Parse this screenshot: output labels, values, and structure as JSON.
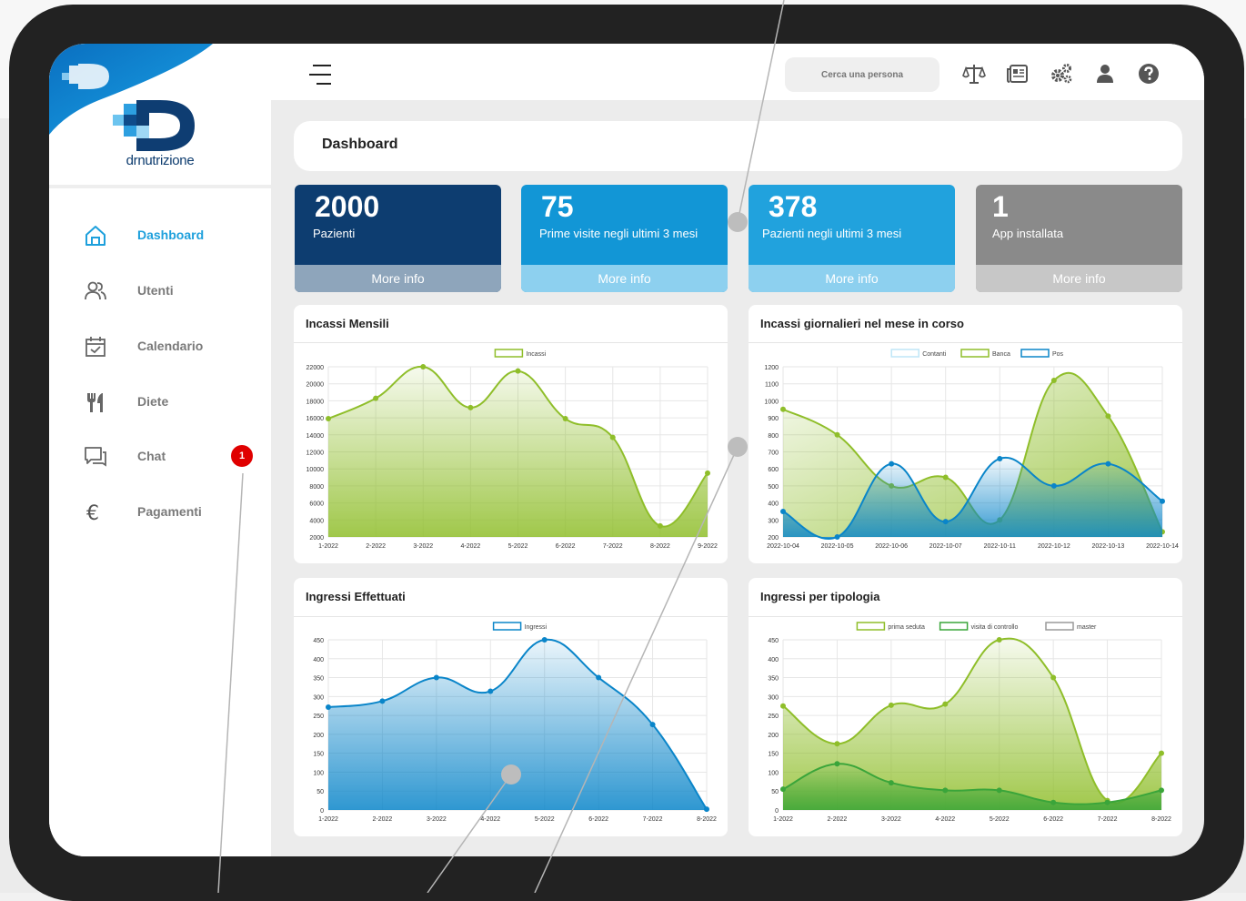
{
  "app": {
    "brand": "drnutrizione"
  },
  "sidebar": {
    "items": [
      {
        "label": "Dashboard",
        "icon": "home-icon"
      },
      {
        "label": "Utenti",
        "icon": "users-icon"
      },
      {
        "label": "Calendario",
        "icon": "calendar-check-icon"
      },
      {
        "label": "Diete",
        "icon": "fork-knife-icon"
      },
      {
        "label": "Chat",
        "icon": "chat-icon",
        "badge": "1"
      },
      {
        "label": "Pagamenti",
        "icon": "euro-icon"
      }
    ]
  },
  "topbar": {
    "search_placeholder": "Cerca una persona",
    "icons": [
      "scale-icon",
      "newspaper-icon",
      "gears-icon",
      "user-icon",
      "help-icon"
    ]
  },
  "page": {
    "title": "Dashboard"
  },
  "stats": [
    {
      "value": "2000",
      "label": "Pazienti",
      "more": "More info",
      "color": "#0d3d70",
      "footer": "#8ea5bb"
    },
    {
      "value": "75",
      "label": "Prime visite negli ultimi 3 mesi",
      "more": "More info",
      "color": "#1296d6",
      "footer": "#8dd0ef"
    },
    {
      "value": "378",
      "label": "Pazienti negli ultimi 3 mesi",
      "more": "More info",
      "color": "#21a2dd",
      "footer": "#8dd0ef"
    },
    {
      "value": "1",
      "label": "App installata",
      "more": "More info",
      "color": "#8a8a8a",
      "footer": "#c7c7c7"
    }
  ],
  "panels": {
    "p1": {
      "title": "Incassi Mensili"
    },
    "p2": {
      "title": "Incassi giornalieri nel mese in corso"
    },
    "p3": {
      "title": "Ingressi Effettuati"
    },
    "p4": {
      "title": "Ingressi per tipologia"
    }
  },
  "chart_data": [
    {
      "type": "area",
      "title": "Incassi Mensili",
      "categories": [
        "1-2022",
        "2-2022",
        "3-2022",
        "4-2022",
        "5-2022",
        "6-2022",
        "7-2022",
        "8-2022",
        "9-2022"
      ],
      "ylim": [
        2000,
        22000
      ],
      "yticks": [
        2000,
        4000,
        6000,
        8000,
        10000,
        12000,
        14000,
        16000,
        18000,
        20000,
        22000
      ],
      "series": [
        {
          "name": "Incassi",
          "color": "#8fbe2a",
          "values": [
            15900,
            18300,
            22000,
            17200,
            21500,
            15900,
            13700,
            3300,
            9500
          ]
        }
      ]
    },
    {
      "type": "area",
      "title": "Incassi giornalieri nel mese in corso",
      "categories": [
        "2022-10-04",
        "2022-10-05",
        "2022-10-06",
        "2022-10-07",
        "2022-10-11",
        "2022-10-12",
        "2022-10-13",
        "2022-10-14"
      ],
      "ylim": [
        200,
        1200
      ],
      "yticks": [
        200,
        300,
        400,
        500,
        600,
        700,
        800,
        900,
        1000,
        1100,
        1200
      ],
      "series": [
        {
          "name": "Contanti",
          "color": "#bfe6f7",
          "values": []
        },
        {
          "name": "Banca",
          "color": "#8fbe2a",
          "values": [
            950,
            800,
            500,
            550,
            300,
            1120,
            910,
            230
          ]
        },
        {
          "name": "Pos",
          "color": "#0a85c9",
          "values": [
            350,
            200,
            630,
            290,
            660,
            500,
            630,
            410
          ]
        }
      ]
    },
    {
      "type": "area",
      "title": "Ingressi Effettuati",
      "categories": [
        "1-2022",
        "2-2022",
        "3-2022",
        "4-2022",
        "5-2022",
        "6-2022",
        "7-2022",
        "8-2022"
      ],
      "ylim": [
        0,
        450
      ],
      "yticks": [
        0,
        50,
        100,
        150,
        200,
        250,
        300,
        350,
        400,
        450
      ],
      "series": [
        {
          "name": "Ingressi",
          "color": "#0a85c9",
          "values": [
            272,
            288,
            350,
            314,
            450,
            350,
            226,
            2
          ]
        }
      ]
    },
    {
      "type": "area",
      "title": "Ingressi per tipologia",
      "categories": [
        "1-2022",
        "2-2022",
        "3-2022",
        "4-2022",
        "5-2022",
        "6-2022",
        "7-2022",
        "8-2022"
      ],
      "ylim": [
        0,
        450
      ],
      "yticks": [
        0,
        50,
        100,
        150,
        200,
        250,
        300,
        350,
        400,
        450
      ],
      "series": [
        {
          "name": "prima seduta",
          "color": "#8fbe2a",
          "values": [
            275,
            175,
            277,
            280,
            450,
            350,
            25,
            150
          ]
        },
        {
          "name": "visita di controllo",
          "color": "#3aa53a",
          "values": [
            55,
            122,
            72,
            52,
            52,
            20,
            20,
            52
          ]
        },
        {
          "name": "master",
          "color": "#9a9a9a",
          "values": []
        }
      ]
    }
  ]
}
